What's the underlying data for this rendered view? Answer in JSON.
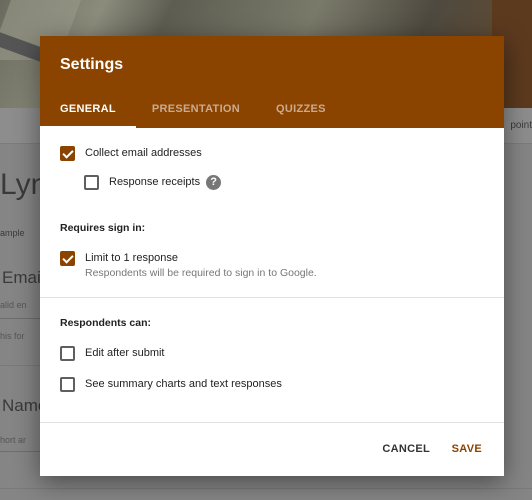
{
  "background": {
    "heading_fragment": "Lyn",
    "sample_fragment": "ample",
    "email_label_fragment": "Emai",
    "email_hint_fragment": "alid en",
    "form_hint_fragment": "his for",
    "name_label_fragment": "Name",
    "short_answer_fragment": "hort ar",
    "points_fragment": "point"
  },
  "dialog": {
    "title": "Settings",
    "tabs": [
      {
        "label": "GENERAL",
        "active": true
      },
      {
        "label": "PRESENTATION",
        "active": false
      },
      {
        "label": "QUIZZES",
        "active": false
      }
    ],
    "general": {
      "collect_email": {
        "label": "Collect email addresses",
        "checked": true
      },
      "response_receipts": {
        "label": "Response receipts",
        "checked": false,
        "help_icon": "?"
      },
      "requires_sign_in": {
        "heading": "Requires sign in:",
        "limit_one": {
          "label": "Limit to 1 response",
          "sublabel": "Respondents will be required to sign in to Google.",
          "checked": true
        }
      },
      "respondents_can": {
        "heading": "Respondents can:",
        "edit_after_submit": {
          "label": "Edit after submit",
          "checked": false
        },
        "see_summary": {
          "label": "See summary charts and text responses",
          "checked": false
        }
      }
    },
    "footer": {
      "cancel_label": "CANCEL",
      "save_label": "SAVE"
    }
  },
  "colors": {
    "accent": "#8b4300",
    "overlay": "#858585"
  }
}
